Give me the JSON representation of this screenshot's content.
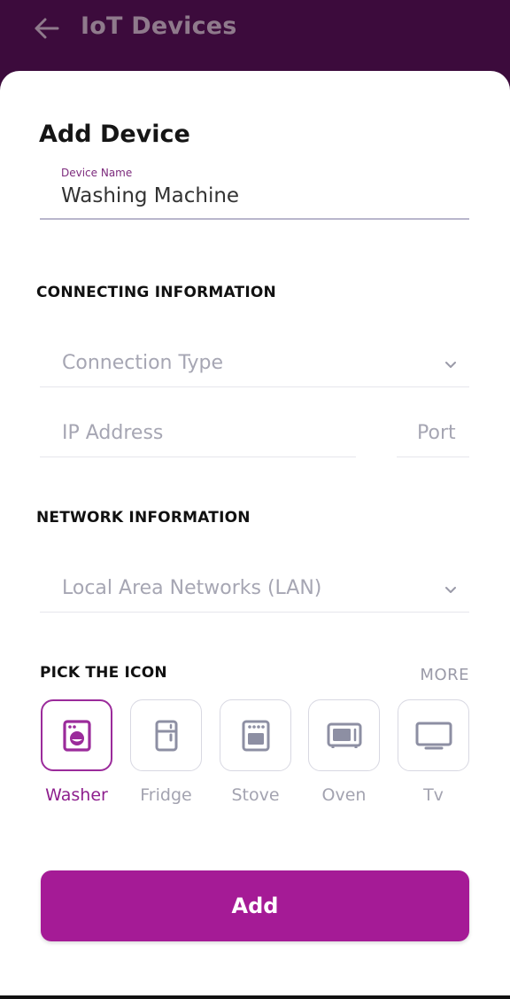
{
  "appbar": {
    "title": "IoT Devices"
  },
  "form": {
    "title": "Add Device",
    "device_name": {
      "label": "Device Name",
      "value": "Washing Machine"
    },
    "connecting": {
      "heading": "CONNECTING INFORMATION",
      "connection_type_placeholder": "Connection Type",
      "ip_placeholder": "IP Address",
      "port_placeholder": "Port"
    },
    "network": {
      "heading": "NETWORK INFORMATION",
      "selected": "Local Area Networks (LAN)"
    },
    "icons": {
      "heading": "PICK THE ICON",
      "more": "MORE",
      "items": [
        {
          "label": "Washer",
          "icon": "washer-icon",
          "selected": true
        },
        {
          "label": "Fridge",
          "icon": "fridge-icon",
          "selected": false
        },
        {
          "label": "Stove",
          "icon": "stove-icon",
          "selected": false
        },
        {
          "label": "Oven",
          "icon": "oven-icon",
          "selected": false
        },
        {
          "label": "Tv",
          "icon": "tv-icon",
          "selected": false
        }
      ]
    },
    "submit_label": "Add"
  },
  "colors": {
    "header_bg": "#3c0b3c",
    "accent": "#a51b96",
    "selected_text": "#8e1f8e",
    "placeholder": "#a6a6b3"
  }
}
